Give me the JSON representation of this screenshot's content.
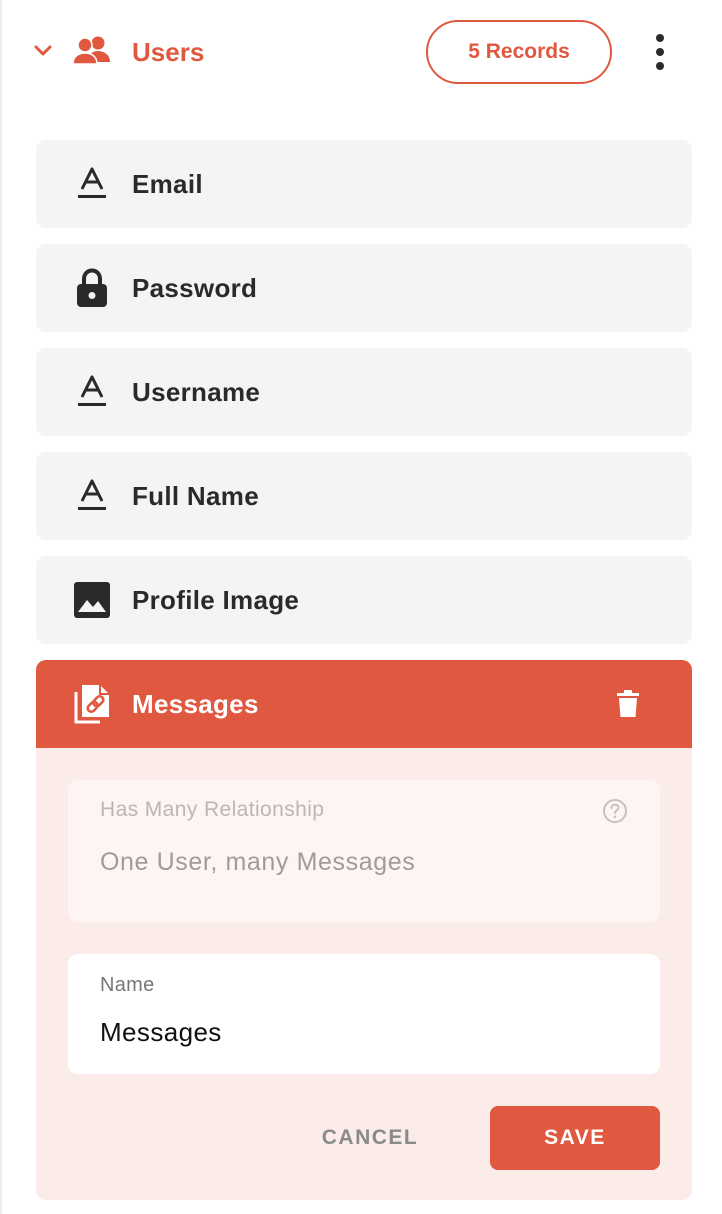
{
  "colors": {
    "accent": "#e0583f",
    "row_background": "#f4f4f4",
    "panel_background": "#fbecea",
    "text_dark": "#2a2a2a"
  },
  "header": {
    "title": "Users",
    "records_label": "5 Records",
    "icons": [
      "chevron-down-icon",
      "users-icon",
      "more-vertical-icon"
    ]
  },
  "fields": [
    {
      "label": "Email",
      "icon": "text-field-icon"
    },
    {
      "label": "Password",
      "icon": "lock-icon"
    },
    {
      "label": "Username",
      "icon": "text-field-icon"
    },
    {
      "label": "Full Name",
      "icon": "text-field-icon"
    },
    {
      "label": "Profile Image",
      "icon": "image-icon"
    }
  ],
  "expanded_field": {
    "label": "Messages",
    "icon": "relationship-icon",
    "relationship": {
      "label": "Has Many Relationship",
      "value": "One User, many Messages"
    },
    "name": {
      "label": "Name",
      "value": "Messages"
    },
    "cancel_label": "CANCEL",
    "save_label": "SAVE"
  }
}
